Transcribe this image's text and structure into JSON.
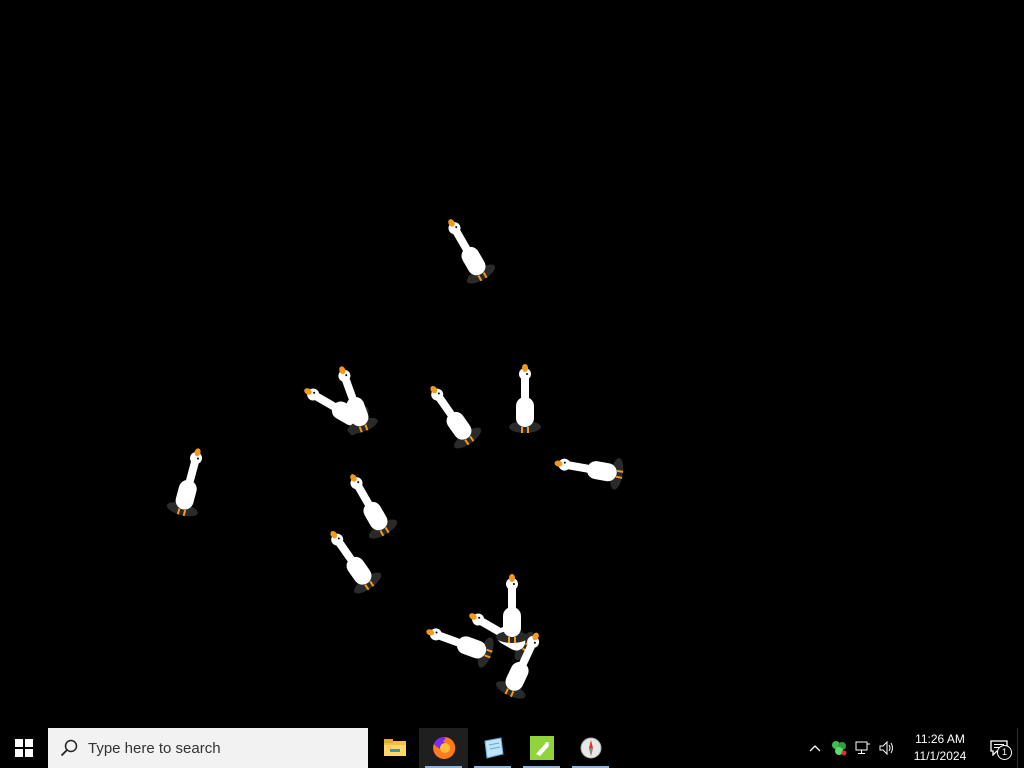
{
  "desktop": {
    "geese": [
      {
        "name": "goose-1"
      },
      {
        "name": "goose-2"
      },
      {
        "name": "goose-3"
      },
      {
        "name": "goose-4"
      },
      {
        "name": "goose-5"
      },
      {
        "name": "goose-6"
      },
      {
        "name": "goose-7"
      },
      {
        "name": "goose-8"
      },
      {
        "name": "goose-9"
      },
      {
        "name": "goose-10"
      },
      {
        "name": "goose-11"
      },
      {
        "name": "goose-12"
      },
      {
        "name": "goose-13"
      }
    ]
  },
  "taskbar": {
    "start_icon": "windows-logo-icon",
    "search": {
      "placeholder": "Type here to search",
      "icon": "search-icon"
    },
    "pinned": [
      {
        "name": "File Explorer",
        "icon": "folder-icon",
        "active": false,
        "running": false
      },
      {
        "name": "Firefox",
        "icon": "firefox-icon",
        "active": true,
        "running": true
      },
      {
        "name": "Notepad",
        "icon": "notepad-icon",
        "active": false,
        "running": true
      },
      {
        "name": "Desktop Goose",
        "icon": "goose-app-icon",
        "active": false,
        "running": true
      },
      {
        "name": "Compass",
        "icon": "compass-icon",
        "active": false,
        "running": true
      }
    ],
    "tray": {
      "icons": [
        "chevron-up-icon",
        "recycle-tray-icon",
        "network-icon",
        "volume-icon"
      ],
      "time": "11:26 AM",
      "date": "11/1/2024",
      "notification_count": "1"
    },
    "colors": {
      "running_underline": "#8cb4e0",
      "search_bg": "#f2f2f2"
    }
  }
}
